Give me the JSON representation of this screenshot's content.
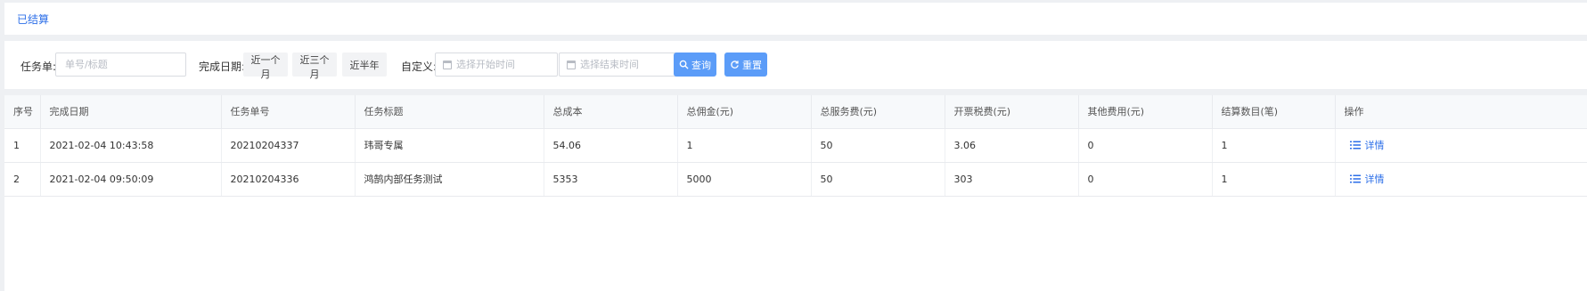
{
  "tabs": {
    "active_label": "已结算"
  },
  "filters": {
    "task_label": "任务单:",
    "task_placeholder": "单号/标题",
    "date_label": "完成日期:",
    "quick_ranges": [
      "近一个月",
      "近三个月",
      "近半年"
    ],
    "custom_label": "自定义:",
    "start_placeholder": "选择开始时间",
    "range_separator": "-",
    "end_placeholder": "选择结束时间",
    "search_label": "查询",
    "reset_label": "重置"
  },
  "table": {
    "columns": [
      "序号",
      "完成日期",
      "任务单号",
      "任务标题",
      "总成本",
      "总佣金(元)",
      "总服务费(元)",
      "开票税费(元)",
      "其他费用(元)",
      "结算数目(笔)",
      "操作"
    ],
    "rows": [
      [
        "1",
        "2021-02-04 10:43:58",
        "20210204337",
        "玮哥专属",
        "54.06",
        "1",
        "50",
        "3.06",
        "0",
        "1"
      ],
      [
        "2",
        "2021-02-04 09:50:09",
        "20210204336",
        "鸿鹄内部任务测试",
        "5353",
        "5000",
        "50",
        "303",
        "0",
        "1"
      ]
    ],
    "action_label": "详情"
  },
  "colors": {
    "accent": "#2d6fe8",
    "button": "#5b9cf8",
    "page_bg": "#eef0f3"
  }
}
